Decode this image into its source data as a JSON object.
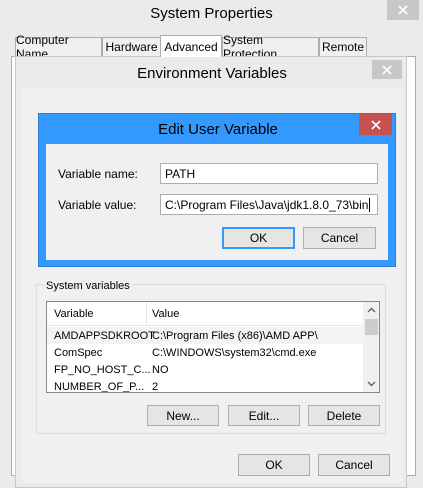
{
  "system_properties": {
    "title": "System Properties",
    "tabs": [
      "Computer Name",
      "Hardware",
      "Advanced",
      "System Protection",
      "Remote"
    ]
  },
  "env_vars": {
    "title": "Environment Variables",
    "system_section_label": "System variables",
    "columns": [
      "Variable",
      "Value"
    ],
    "rows": [
      {
        "variable": "AMDAPPSDKROOT",
        "value": "C:\\Program Files (x86)\\AMD APP\\"
      },
      {
        "variable": "ComSpec",
        "value": "C:\\WINDOWS\\system32\\cmd.exe"
      },
      {
        "variable": "FP_NO_HOST_C...",
        "value": "NO"
      },
      {
        "variable": "NUMBER_OF_P...",
        "value": "2"
      }
    ],
    "new_label": "New...",
    "edit_label": "Edit...",
    "delete_label": "Delete",
    "ok_label": "OK",
    "cancel_label": "Cancel"
  },
  "edit_dialog": {
    "title": "Edit User Variable",
    "name_label": "Variable name:",
    "name_value": "PATH",
    "value_label": "Variable value:",
    "value_value": "C:\\Program Files\\Java\\jdk1.8.0_73\\bin",
    "ok_label": "OK",
    "cancel_label": "Cancel"
  },
  "colors": {
    "accent": "#3399ff",
    "close_red": "#c75050",
    "frame_inactive": "#ebebeb"
  },
  "icons": [
    "close-icon",
    "scroll-up-icon",
    "scroll-down-icon"
  ]
}
